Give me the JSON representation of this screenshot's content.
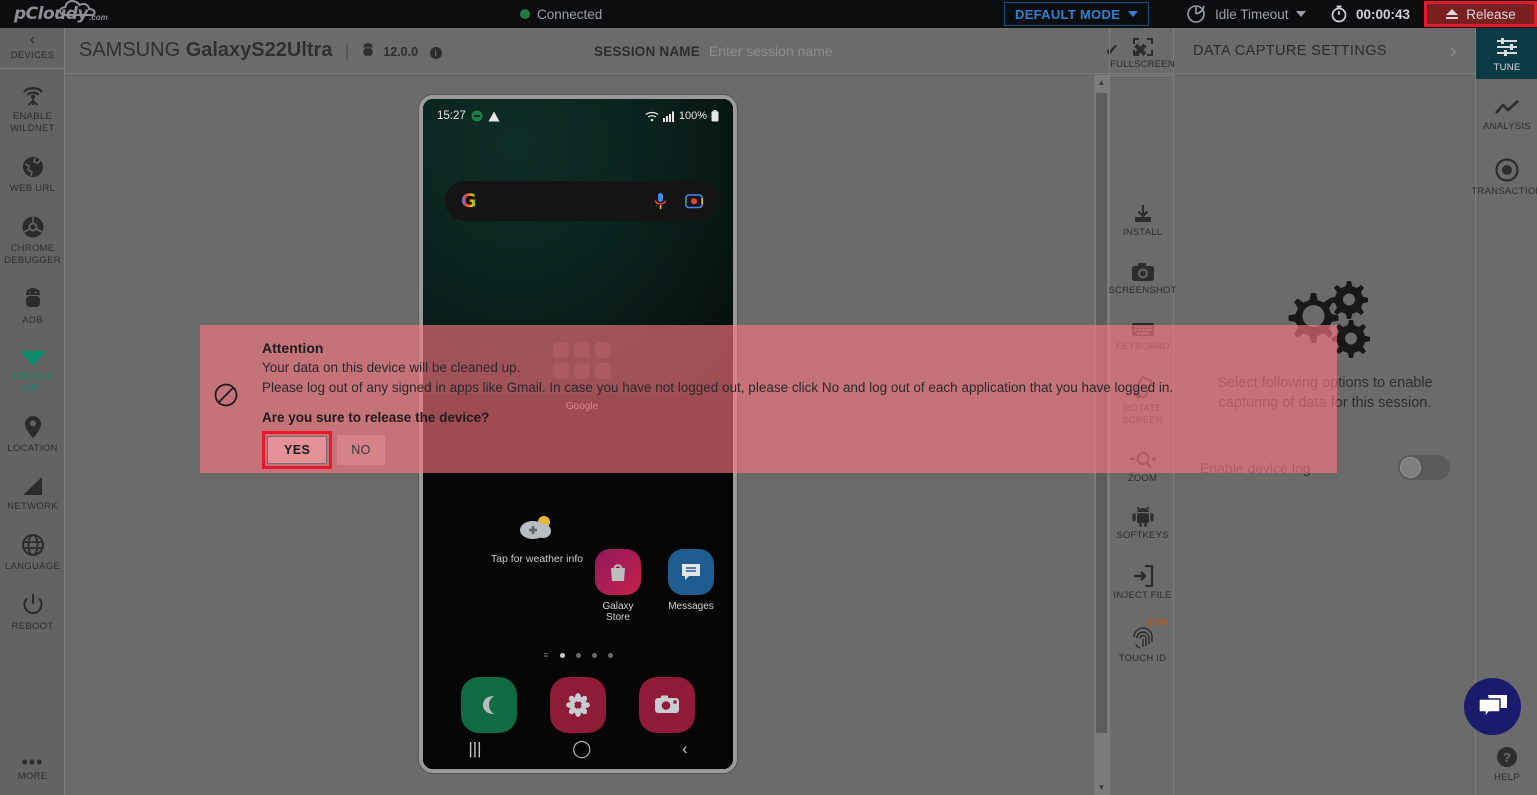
{
  "topbar": {
    "logo_text": "pCloudy",
    "logo_suffix": ".com",
    "connection_status": "Connected",
    "connection_color": "#1d7a41",
    "mode_label": "DEFAULT MODE",
    "idle_label": "Idle Timeout",
    "timer": "00:00:43",
    "release_label": "Release",
    "highlight_color": "#e8192c"
  },
  "device_header": {
    "brand": "SAMSUNG",
    "model": "GalaxyS22Ultra",
    "separator": "|",
    "os_version": "12.0.0",
    "info_glyph": "i",
    "session_label": "SESSION NAME",
    "session_value": "",
    "session_placeholder": "Enter session name",
    "confirm_glyph": "✔",
    "cancel_glyph": "✖",
    "fullscreen_label": "FULLSCREEN"
  },
  "left_sidebar": {
    "collapse_label": "DEVICES",
    "items": [
      {
        "label": "ENABLE WILDNET",
        "icon": "wildnet-icon",
        "active": false
      },
      {
        "label": "WEB URL",
        "icon": "globe-icon",
        "active": false
      },
      {
        "label": "CHROME DEBUGGER",
        "icon": "chrome-icon",
        "active": false
      },
      {
        "label": "ADB",
        "icon": "android-bug-icon",
        "active": false
      },
      {
        "label": "TOGGLE WIFI",
        "icon": "wifi-icon",
        "active": true
      },
      {
        "label": "LOCATION",
        "icon": "location-pin-icon",
        "active": false
      },
      {
        "label": "NETWORK",
        "icon": "signal-bars-icon",
        "active": false
      },
      {
        "label": "LANGUAGE",
        "icon": "globe-grid-icon",
        "active": false
      },
      {
        "label": "REBOOT",
        "icon": "power-icon",
        "active": false
      }
    ],
    "more_label": "MORE",
    "active_color": "#0c8c6a"
  },
  "device_toolbar": {
    "items": [
      {
        "label": "INSTALL",
        "icon": "download-install-icon"
      },
      {
        "label": "SCREENSHOT",
        "icon": "camera-icon"
      },
      {
        "label": "KEYBOARD",
        "icon": "keyboard-icon"
      },
      {
        "label": "ROTATE SCREEN",
        "icon": "rotate-icon"
      },
      {
        "label": "ZOOM",
        "icon": "magnifier-icon"
      },
      {
        "label": "SOFTKEYS",
        "icon": "android-robot-icon"
      },
      {
        "label": "INJECT FILE",
        "icon": "inject-file-icon"
      },
      {
        "label": "TOUCH ID",
        "icon": "fingerprint-icon",
        "badge": "BETA"
      }
    ]
  },
  "data_capture": {
    "title": "DATA CAPTURE SETTINGS",
    "chevron": "›",
    "illustration": "gears-icon",
    "description": "Select following options to enable capturing of data for this session.",
    "toggle_label": "Enable device log",
    "toggle_on": false
  },
  "far_sidebar": {
    "items": [
      {
        "label": "TUNE",
        "icon": "sliders-icon",
        "active": true
      },
      {
        "label": "ANALYSIS",
        "icon": "line-chart-icon",
        "active": false
      },
      {
        "label": "TRANSACTION",
        "icon": "record-circle-icon",
        "active": false
      }
    ],
    "help_label": "HELP",
    "active_bg": "#0d3b45"
  },
  "chat": {
    "icon": "chat-bubbles-icon",
    "color": "#1b1b6e"
  },
  "phone": {
    "status_time": "15:27",
    "battery": "100%",
    "google_folder_label": "Google",
    "weather_label": "Tap for weather info",
    "home_apps": [
      {
        "name": "Galaxy Store",
        "icon": "galaxy-store-icon"
      },
      {
        "name": "Messages",
        "icon": "messages-icon"
      }
    ],
    "page_dots": 4,
    "active_dot": 0,
    "dock_apps": [
      {
        "name": "phone",
        "icon": "phone-icon"
      },
      {
        "name": "contacts",
        "icon": "contacts-flower-icon"
      },
      {
        "name": "camera",
        "icon": "camera-app-icon"
      }
    ],
    "nav": {
      "recents": "|||",
      "home": "◯",
      "back": "‹"
    }
  },
  "modal": {
    "icon": "blocked-icon",
    "title": "Attention",
    "line1": "Your data on this device will be cleaned up.",
    "line2": "Please log out of any signed in apps like Gmail. In case you have not logged out, please click No and log out of each application that you have logged in.",
    "question": "Are you sure to release the device?",
    "yes_label": "YES",
    "no_label": "NO",
    "background": "rgba(255,120,130,0.62)"
  }
}
